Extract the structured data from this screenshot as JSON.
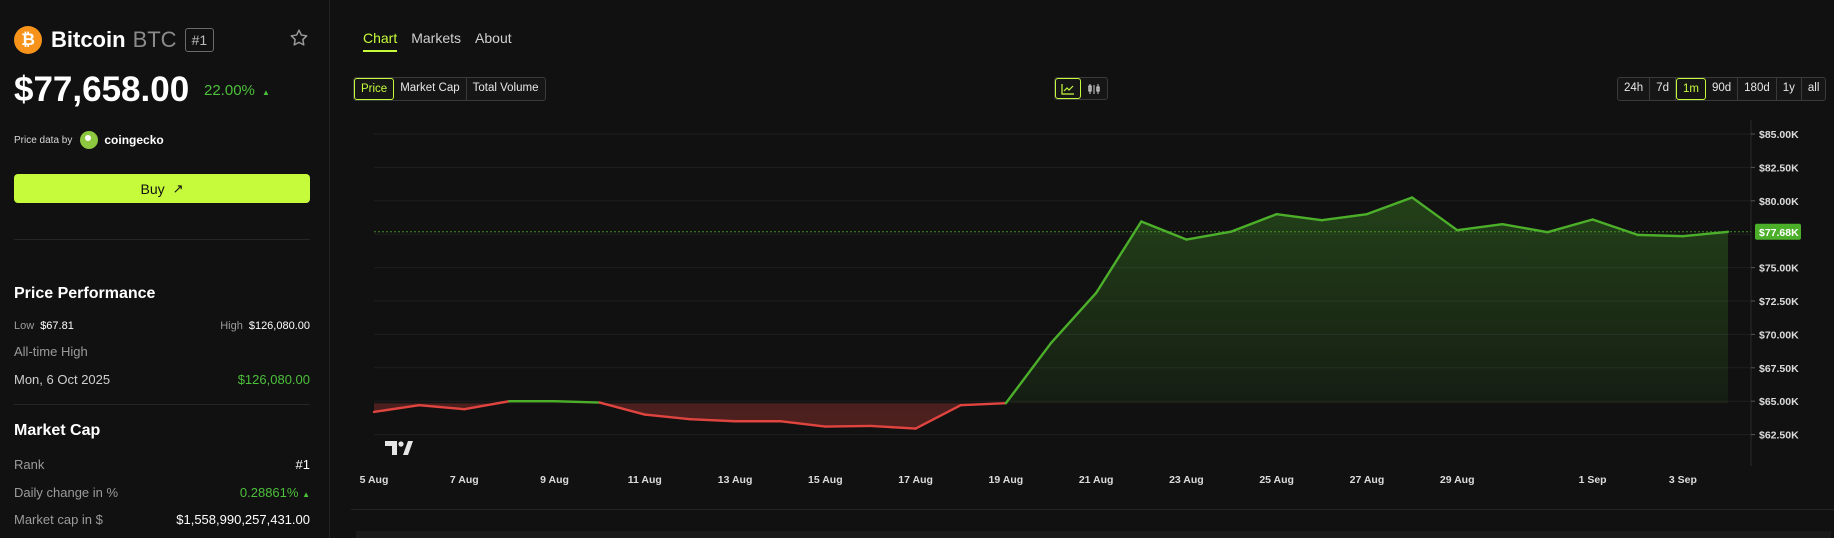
{
  "coin": {
    "logo": "₿",
    "name": "Bitcoin",
    "symbol": "BTC",
    "rank": "#1",
    "price": "$77,658.00",
    "change": "22.00%",
    "change_arrow": "▲"
  },
  "price_data": {
    "label": "Price data by",
    "provider": "coingecko"
  },
  "buy": {
    "label": "Buy",
    "icon": "↗"
  },
  "performance": {
    "title": "Price Performance",
    "low_label": "Low",
    "low_value": "$67.81",
    "high_label": "High",
    "high_value": "$126,080.00",
    "ath_label": "All-time High",
    "ath_date": "Mon, 6 Oct 2025",
    "ath_value": "$126,080.00"
  },
  "market_cap": {
    "title": "Market Cap",
    "rank_label": "Rank",
    "rank_value": "#1",
    "daily_label": "Daily change in %",
    "daily_value": "0.28861%",
    "daily_arrow": "▲",
    "cap_label": "Market cap in $",
    "cap_value": "$1,558,990,257,431.00"
  },
  "tabs": [
    "Chart",
    "Markets",
    "About"
  ],
  "metrics": [
    "Price",
    "Market Cap",
    "Total Volume"
  ],
  "ranges": [
    "24h",
    "7d",
    "1m",
    "90d",
    "180d",
    "1y",
    "all"
  ],
  "chart_icons": [
    "line-chart-icon",
    "candlestick-icon"
  ],
  "colors": {
    "accent": "#c6fb3c",
    "up": "#4caf2a",
    "down": "#e0443f",
    "bg": "#111111"
  },
  "chart_data": {
    "type": "line",
    "title": "",
    "xlabel": "",
    "ylabel": "",
    "x_tick_labels": [
      "5 Aug",
      "7 Aug",
      "9 Aug",
      "11 Aug",
      "13 Aug",
      "15 Aug",
      "17 Aug",
      "19 Aug",
      "21 Aug",
      "23 Aug",
      "25 Aug",
      "27 Aug",
      "29 Aug",
      "1 Sep",
      "3 Sep"
    ],
    "y_tick_labels": [
      "$85.00K",
      "$82.50K",
      "$80.00K",
      "$77.68K",
      "$75.00K",
      "$72.50K",
      "$70.00K",
      "$67.50K",
      "$65.00K",
      "$62.50K"
    ],
    "ylim": [
      61000,
      85000
    ],
    "current_value_label": "$77.68K",
    "current_value": 77680,
    "baseline": 64850,
    "series": [
      {
        "values": [
          64200,
          64700,
          64400,
          65000,
          65000,
          64900,
          64000,
          63650,
          63500,
          63500,
          63100,
          63150,
          62950,
          64700,
          64850,
          69350,
          73100,
          78450,
          77100,
          77700,
          79000,
          78550,
          79000,
          80250,
          77800,
          78250,
          77650,
          78600,
          77450,
          77350,
          77680
        ]
      }
    ]
  },
  "branding": {
    "icon": "tradingview-logo-icon"
  }
}
